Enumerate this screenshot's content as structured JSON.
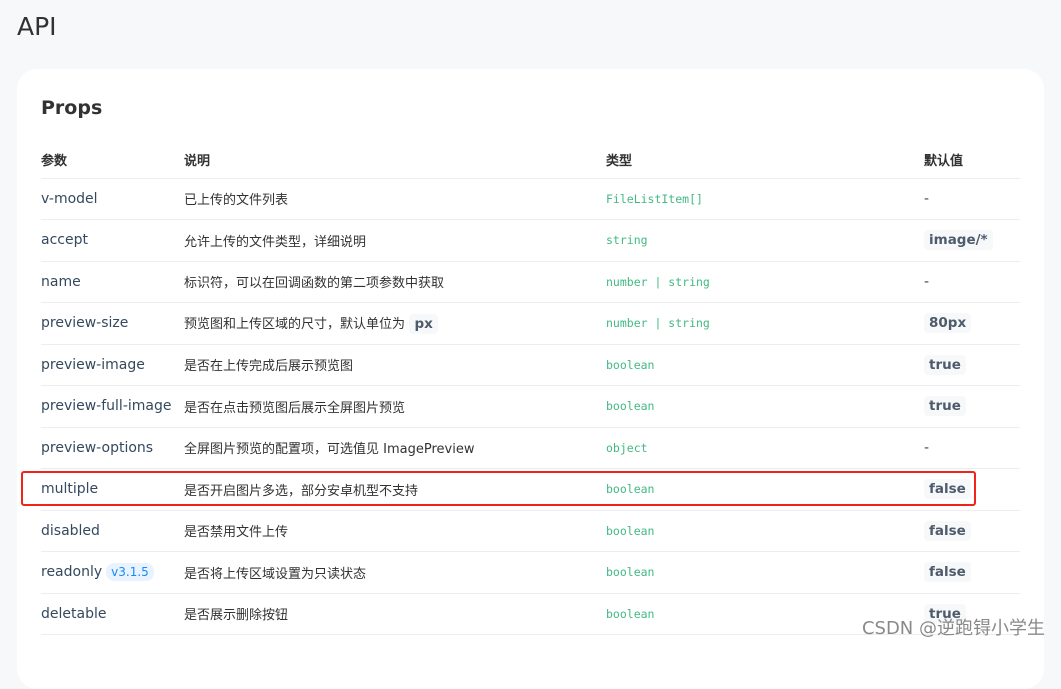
{
  "page_title": "API",
  "section_title": "Props",
  "headers": [
    "参数",
    "说明",
    "类型",
    "默认值"
  ],
  "rows": [
    {
      "name": "v-model",
      "desc": "已上传的文件列表",
      "type": "FileListItem[]",
      "default": "-"
    },
    {
      "name": "accept",
      "desc": "允许上传的文件类型，",
      "desc_link": "详细说明",
      "type": "string",
      "default_code": "image/*"
    },
    {
      "name": "name",
      "desc": "标识符，可以在回调函数的第二项参数中获取",
      "type": "number | string",
      "default": "-"
    },
    {
      "name": "preview-size",
      "desc": "预览图和上传区域的尺寸，默认单位为",
      "desc_code": "px",
      "type": "number | string",
      "default_code": "80px"
    },
    {
      "name": "preview-image",
      "desc": "是否在上传完成后展示预览图",
      "type": "boolean",
      "default_code": "true"
    },
    {
      "name": "preview-full-image",
      "desc": "是否在点击预览图后展示全屏图片预览",
      "type": "boolean",
      "default_code": "true"
    },
    {
      "name": "preview-options",
      "desc": "全屏图片预览的配置项，可选值见 ",
      "desc_link": "ImagePreview",
      "type": "object",
      "default": "-"
    },
    {
      "name": "multiple",
      "desc": "是否开启图片多选，部分安卓机型不支持",
      "type": "boolean",
      "default_code": "false",
      "highlighted": true
    },
    {
      "name": "disabled",
      "desc": "是否禁用文件上传",
      "type": "boolean",
      "default_code": "false"
    },
    {
      "name": "readonly",
      "badge": "v3.1.5",
      "desc": "是否将上传区域设置为只读状态",
      "type": "boolean",
      "default_code": "false"
    },
    {
      "name": "deletable",
      "desc": "是否展示删除按钮",
      "type": "boolean",
      "default_code": "true"
    }
  ],
  "watermark": "CSDN @逆跑锝小学生",
  "colors": {
    "type": "#42b983",
    "link": "#1989fa",
    "highlight_border": "#f2231b"
  }
}
